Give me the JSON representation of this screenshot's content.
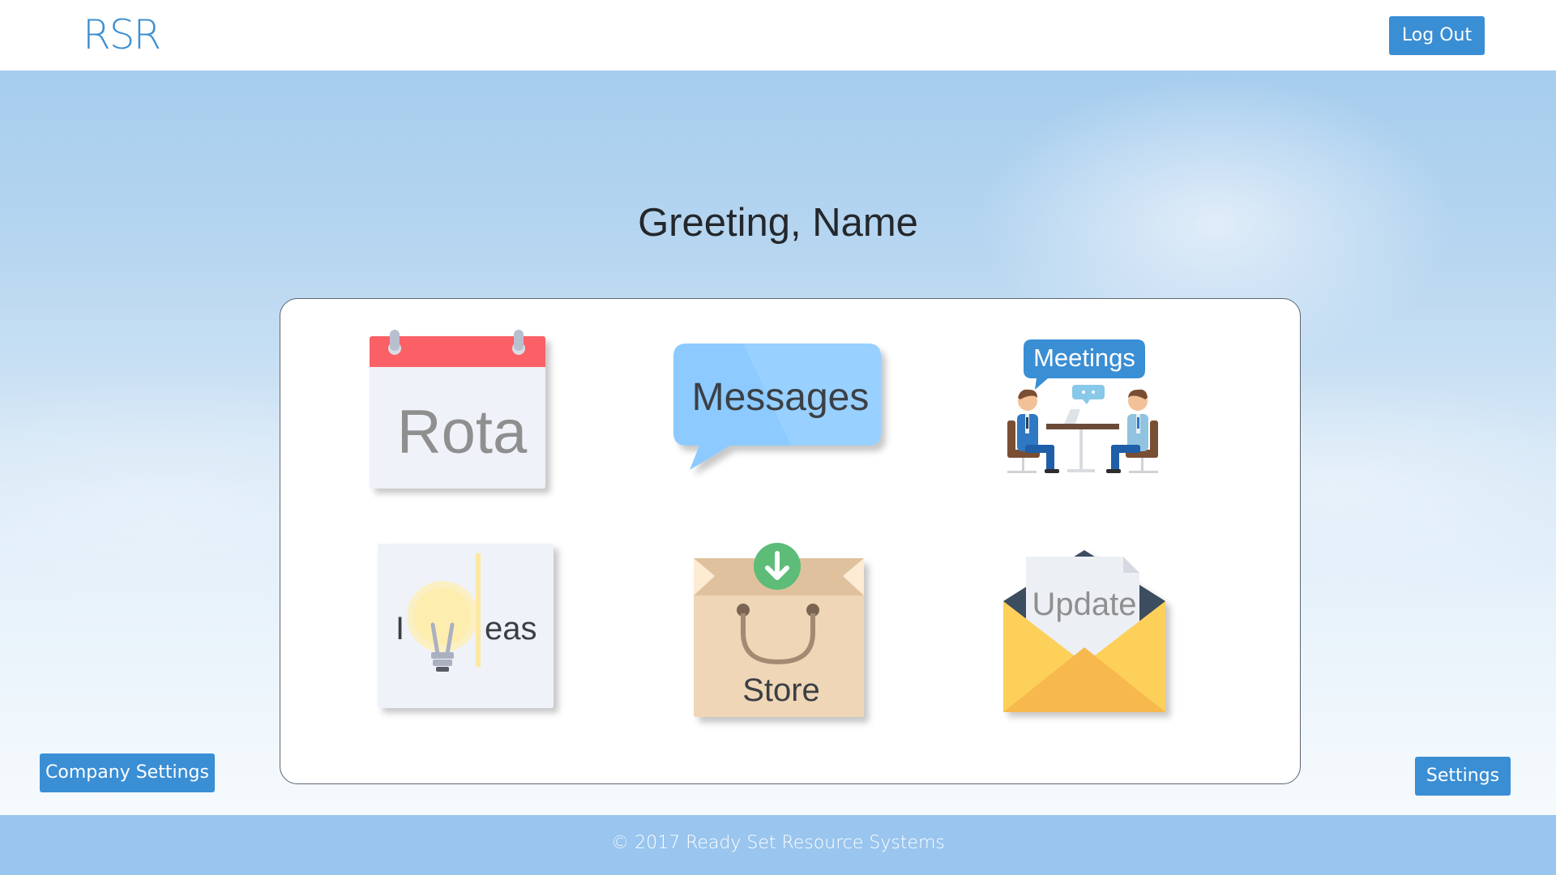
{
  "header": {
    "logo": "RSR",
    "logout_label": "Log Out"
  },
  "main": {
    "greeting": "Greeting, Name",
    "tiles": [
      {
        "label": "Rota",
        "icon": "calendar-icon"
      },
      {
        "label": "Messages",
        "icon": "speech-bubble-icon"
      },
      {
        "label": "Meetings",
        "icon": "meeting-people-icon"
      },
      {
        "label_prefix": "I",
        "label_suffix": "eas",
        "icon": "lightbulb-icon"
      },
      {
        "label": "Store",
        "icon": "shopping-bag-download-icon"
      },
      {
        "label": "Update",
        "icon": "envelope-letter-icon"
      }
    ]
  },
  "bottom": {
    "company_settings_label": "Company Settings",
    "settings_label": "Settings"
  },
  "footer": {
    "copyright": "© 2017 Ready Set Resource Systems"
  },
  "colors": {
    "accent": "#3a8ed4",
    "footer": "#99c5ee",
    "logo": "#3f8fd0"
  }
}
